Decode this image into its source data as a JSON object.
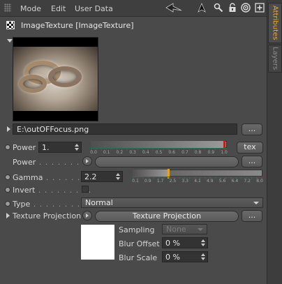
{
  "menu": {
    "items": [
      "Mode",
      "Edit",
      "User Data"
    ]
  },
  "toolbar_icons": [
    "back-arrow-icon",
    "pointer-icon",
    "search-icon",
    "lock-icon",
    "target-icon",
    "add-panel-icon"
  ],
  "header": {
    "title": "ImageTexture [ImageTexture]"
  },
  "file": {
    "path": "E:\\outOFFocus.png",
    "browse_label": "..."
  },
  "params": {
    "power": {
      "label": "Power",
      "value": "1.",
      "slider_ticks": [
        "0.0",
        "0.1",
        "0.2",
        "0.3",
        "0.4",
        "0.5",
        "0.6",
        "0.7",
        "0.8",
        "0.9",
        "1.0"
      ],
      "slider_level": 1.0,
      "tex_button": "tex"
    },
    "power_tex": {
      "label": "Power",
      "dots": " . . . . . . . . .",
      "browse_label": "..."
    },
    "gamma": {
      "label": "Gamma",
      "dots": " . . . . . . . . .",
      "value": "2.2",
      "slider_ticks": [
        "0.1",
        "0.9",
        "1.7",
        "2.5",
        "3.3",
        "4.1",
        "4.9",
        "5.6",
        "6.4",
        "7.2",
        "8.0"
      ],
      "slider_level": 2.2
    },
    "invert": {
      "label": "Invert",
      "dots": " . . . . . . . . .",
      "checked": false
    },
    "type": {
      "label": "Type",
      "dots": " . . . . . . . . . . .",
      "value": "Normal"
    },
    "texture_projection": {
      "label": "Texture Projection",
      "button": "Texture Projection",
      "browse_label": "..."
    },
    "sampling": {
      "label": "Sampling",
      "value": "None"
    },
    "blur_offset": {
      "label": "Blur Offset",
      "value": "0 %"
    },
    "blur_scale": {
      "label": "Blur Scale",
      "value": "0 %"
    }
  },
  "side_tabs": [
    {
      "label": "Attributes",
      "active": true
    },
    {
      "label": "Layers",
      "active": false
    }
  ],
  "colors": {
    "power_marker": "#c0201a",
    "gamma_marker": "#e8a020",
    "active_tab": "#e6a640"
  }
}
